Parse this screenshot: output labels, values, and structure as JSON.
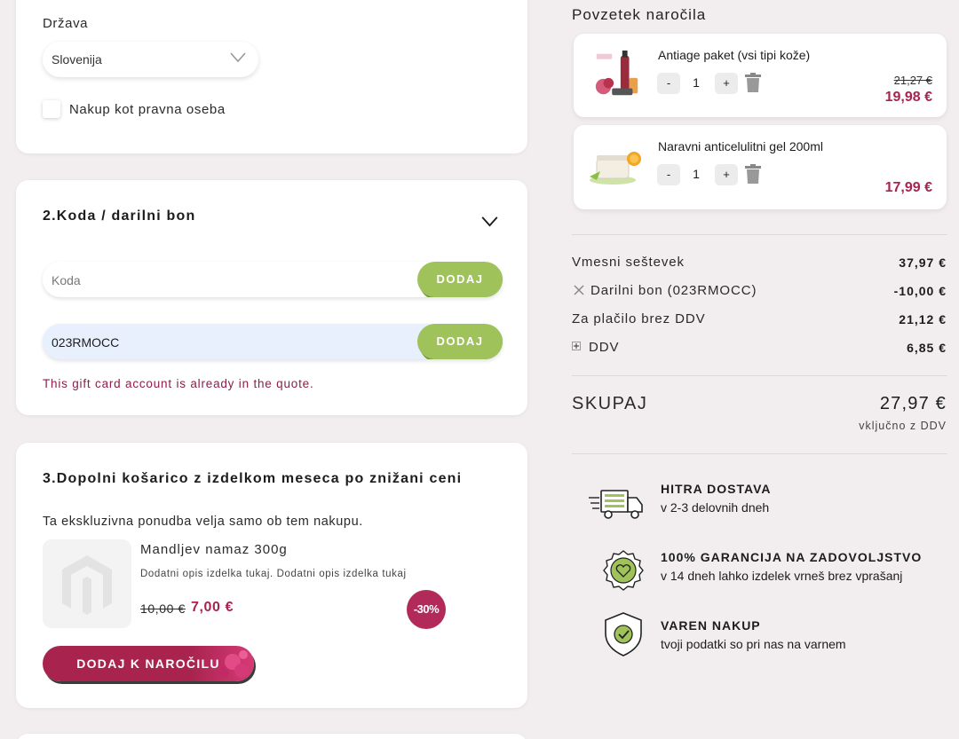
{
  "address": {
    "country_label": "Država",
    "country_value": "Slovenija",
    "legal_entity_label": "Nakup kot pravna oseba"
  },
  "coupon": {
    "title": "2.Koda / darilni bon",
    "code_placeholder": "Koda",
    "add_label": "DODAJ",
    "gift_value": "023RMOCC",
    "gift_add_label": "DODAJ",
    "error": "This gift card account is already in the quote."
  },
  "upsell": {
    "title": "3.Dopolni košarico z izdelkom meseca po znižani ceni",
    "note": "Ta ekskluzivna ponudba velja samo ob tem nakupu.",
    "product_name": "Mandljev namaz 300g",
    "product_desc": "Dodatni opis izdelka tukaj. Dodatni opis izdelka tukaj",
    "old_price": "10,00 €",
    "new_price": "7,00 €",
    "discount": "-30%",
    "button": "DODAJ K NAROČILU"
  },
  "summary": {
    "title": "Povzetek naročila",
    "items": [
      {
        "name": "Antiage paket (vsi tipi kože)",
        "qty": "1",
        "old_price": "21,27 €",
        "price": "19,98 €"
      },
      {
        "name": "Naravni anticelulitni gel 200ml",
        "qty": "1",
        "price": "17,99 €"
      }
    ],
    "minus": "-",
    "plus": "+",
    "rows": [
      {
        "label": "Vmesni seštevek",
        "value": "37,97 €"
      },
      {
        "label": "Darilni bon (023RMOCC)",
        "value": "-10,00 €"
      },
      {
        "label": "Za plačilo brez DDV",
        "value": "21,12 €"
      },
      {
        "label": "DDV",
        "value": "6,85 €"
      }
    ],
    "total_label": "SKUPAJ",
    "total_value": "27,97 €",
    "total_note": "vključno z DDV"
  },
  "features": [
    {
      "title": "HITRA DOSTAVA",
      "subtitle": "v 2-3 delovnih dneh",
      "icon": "delivery-truck-icon"
    },
    {
      "title": "100% GARANCIJA NA ZADOVOLJSTVO",
      "subtitle": "v 14 dneh lahko izdelek vrneš brez vprašanj",
      "icon": "guarantee-seal-icon"
    },
    {
      "title": "VAREN NAKUP",
      "subtitle": "tvoji podatki so pri nas na varnem",
      "icon": "secure-shield-icon"
    }
  ],
  "colors": {
    "accent_green": "#9fc25a",
    "accent_berry": "#a8244f",
    "background": "#f2eeef"
  }
}
